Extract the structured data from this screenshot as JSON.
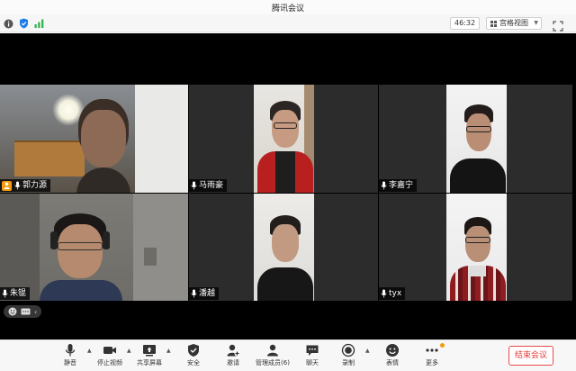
{
  "window": {
    "title": "腾讯会议"
  },
  "infobar": {
    "timer": "46:32",
    "view_mode": "宫格视图"
  },
  "participants": [
    {
      "name": "郭力源",
      "host": true,
      "active_speaker": true
    },
    {
      "name": "马雨豪"
    },
    {
      "name": "李嘉宁"
    },
    {
      "name": "朱锟"
    },
    {
      "name": "潘越"
    },
    {
      "name": "tyx"
    }
  ],
  "toolbar": {
    "mute": "静音",
    "stop_video": "停止视频",
    "share_screen": "共享屏幕",
    "security": "安全",
    "invite": "邀请",
    "manage_members": "管理成员(6)",
    "chat": "聊天",
    "record": "录制",
    "reactions": "表情",
    "more": "更多",
    "end_meeting": "结束会议"
  },
  "icons": {
    "info": "info-icon",
    "shield": "shield-icon",
    "signal": "signal-icon",
    "grid": "grid-icon",
    "fullscreen": "fullscreen-icon"
  },
  "colors": {
    "active_border": "#2bd24a",
    "end_button": "#e23b3b",
    "host_badge": "#f39c12"
  }
}
